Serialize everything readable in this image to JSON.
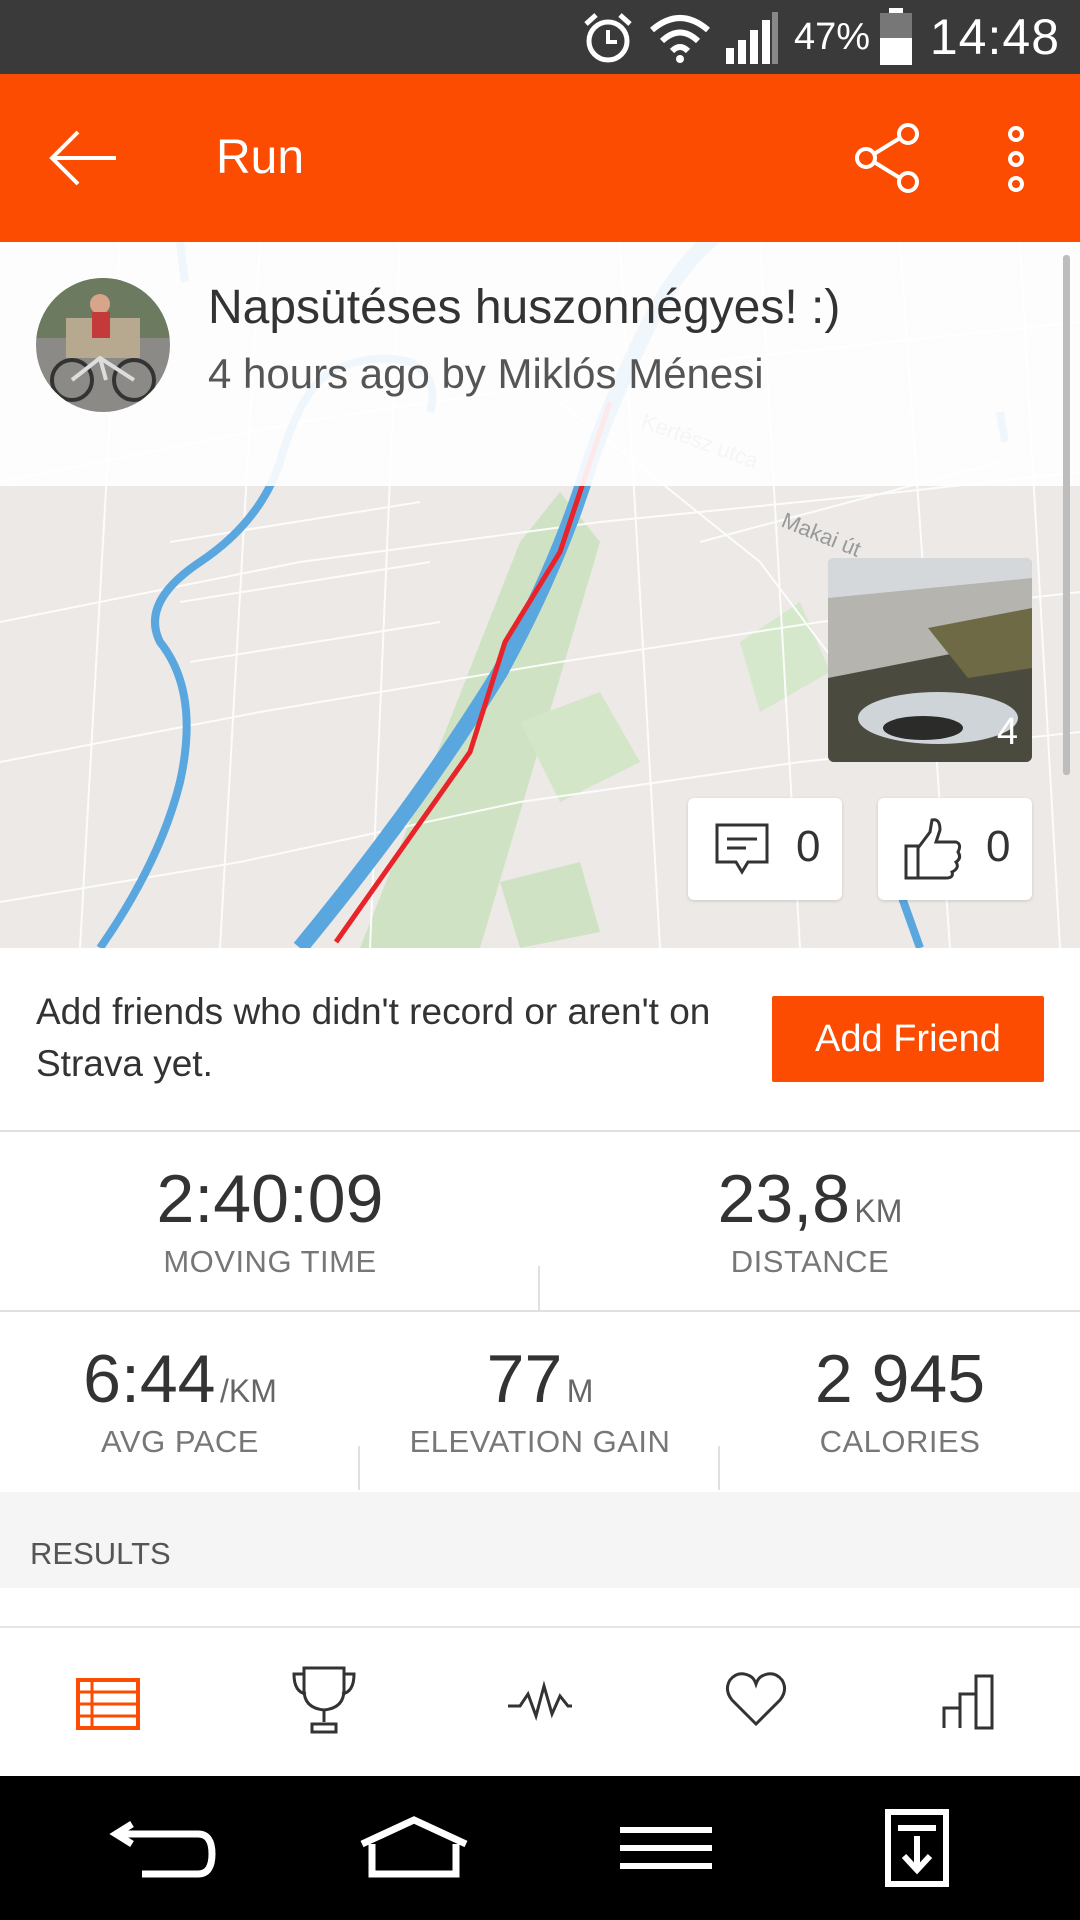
{
  "status_bar": {
    "battery_percent": "47%",
    "time": "14:48",
    "icons": [
      "alarm-icon",
      "wifi-icon",
      "signal-icon",
      "battery-icon"
    ]
  },
  "app_bar": {
    "title": "Run",
    "icons": [
      "back-arrow-icon",
      "share-icon",
      "overflow-menu-icon"
    ]
  },
  "activity": {
    "title": "Napsütéses huszonnégyes! :)",
    "subtitle": "4 hours ago by Miklós Ménesi"
  },
  "map": {
    "street_labels": [
      "Kertész utca",
      "Makai út"
    ],
    "photo_count": "4",
    "comments_count": "0",
    "kudos_count": "0",
    "route_color": "#e8242a",
    "river_color": "#5aa7e0"
  },
  "friends": {
    "text": "Add friends who didn't record or aren't on Strava yet.",
    "button_label": "Add Friend"
  },
  "stats": {
    "moving_time": {
      "value": "2:40:09",
      "label": "MOVING TIME"
    },
    "distance": {
      "value": "23,8",
      "unit": "KM",
      "label": "DISTANCE"
    },
    "avg_pace": {
      "value": "6:44",
      "unit": "/KM",
      "label": "AVG PACE"
    },
    "elevation": {
      "value": "77",
      "unit": "M",
      "label": "ELEVATION GAIN"
    },
    "calories": {
      "value": "2 945",
      "label": "CALORIES"
    }
  },
  "results": {
    "label": "RESULTS"
  },
  "tabs": [
    {
      "name": "overview",
      "icon": "list-icon",
      "active": true
    },
    {
      "name": "achievements",
      "icon": "trophy-icon",
      "active": false
    },
    {
      "name": "analysis",
      "icon": "pulse-icon",
      "active": false
    },
    {
      "name": "kudos",
      "icon": "heart-icon",
      "active": false
    },
    {
      "name": "stats",
      "icon": "bar-chart-icon",
      "active": false
    }
  ],
  "colors": {
    "accent": "#fc4c02",
    "status_bar": "#3a3a3a",
    "nav_bar": "#000000"
  }
}
